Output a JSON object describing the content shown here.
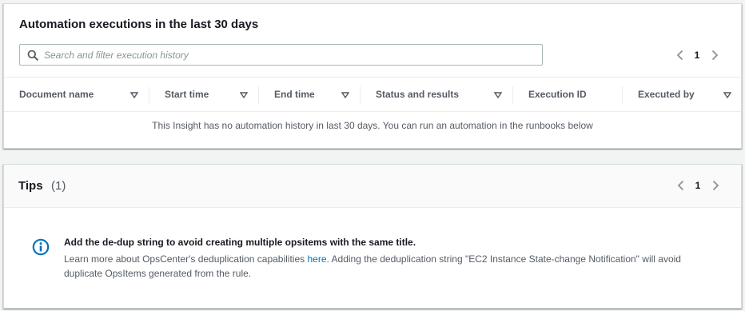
{
  "executions_panel": {
    "title": "Automation executions in the last 30 days",
    "search_placeholder": "Search and filter execution history",
    "page": "1",
    "columns": [
      {
        "label": "Document name",
        "sortable": true
      },
      {
        "label": "Start time",
        "sortable": true
      },
      {
        "label": "End time",
        "sortable": true
      },
      {
        "label": "Status and results",
        "sortable": true
      },
      {
        "label": "Execution ID",
        "sortable": false
      },
      {
        "label": "Executed by",
        "sortable": true
      }
    ],
    "empty_message": "This Insight has no automation history in last 30 days. You can run an automation in the runbooks below"
  },
  "tips_panel": {
    "title": "Tips",
    "count": "(1)",
    "page": "1",
    "tip": {
      "icon": "info-icon",
      "title": "Add the de-dup string to avoid creating multiple opsitems with the same title.",
      "body_before": "Learn more about OpsCenter's deduplication capabilities ",
      "link_text": "here",
      "body_after": ". Adding the deduplication string \"EC2 Instance State-change Notification\" will avoid duplicate OpsItems generated from the rule."
    }
  },
  "colors": {
    "accent": "#0073bb",
    "text_primary": "#16191f",
    "text_secondary": "#545b64",
    "border": "#d5dbdb"
  }
}
